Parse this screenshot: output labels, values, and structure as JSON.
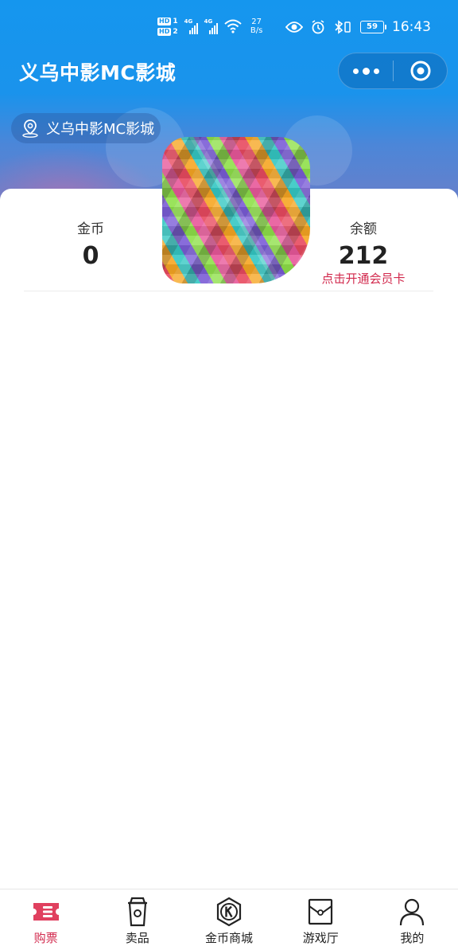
{
  "status_bar": {
    "hd1": "HD",
    "hd1_num": "1",
    "hd2": "HD",
    "hd2_num": "2",
    "net1": "4G",
    "net2": "4G",
    "speed_value": "27",
    "speed_unit": "B/s",
    "battery": "59",
    "time": "16:43"
  },
  "nav": {
    "title": "义乌中影MC影城",
    "more_icon": "more-dots-icon",
    "close_icon": "target-circle-icon"
  },
  "location": {
    "icon": "location-pin-icon",
    "label": "义乌中影MC影城"
  },
  "stats": {
    "coins_label": "金币",
    "coins_value": "0",
    "balance_label": "余额",
    "balance_value": "212",
    "member_link": "点击开通会员卡"
  },
  "colors": {
    "brand_blue": "#1596ee",
    "accent_red": "#d2294d"
  },
  "tabs": [
    {
      "label": "购票",
      "icon": "ticket-icon",
      "active": true
    },
    {
      "label": "卖品",
      "icon": "cup-icon",
      "active": false
    },
    {
      "label": "金币商城",
      "icon": "coin-store-icon",
      "active": false
    },
    {
      "label": "游戏厅",
      "icon": "game-box-icon",
      "active": false
    },
    {
      "label": "我的",
      "icon": "user-icon",
      "active": false
    }
  ]
}
